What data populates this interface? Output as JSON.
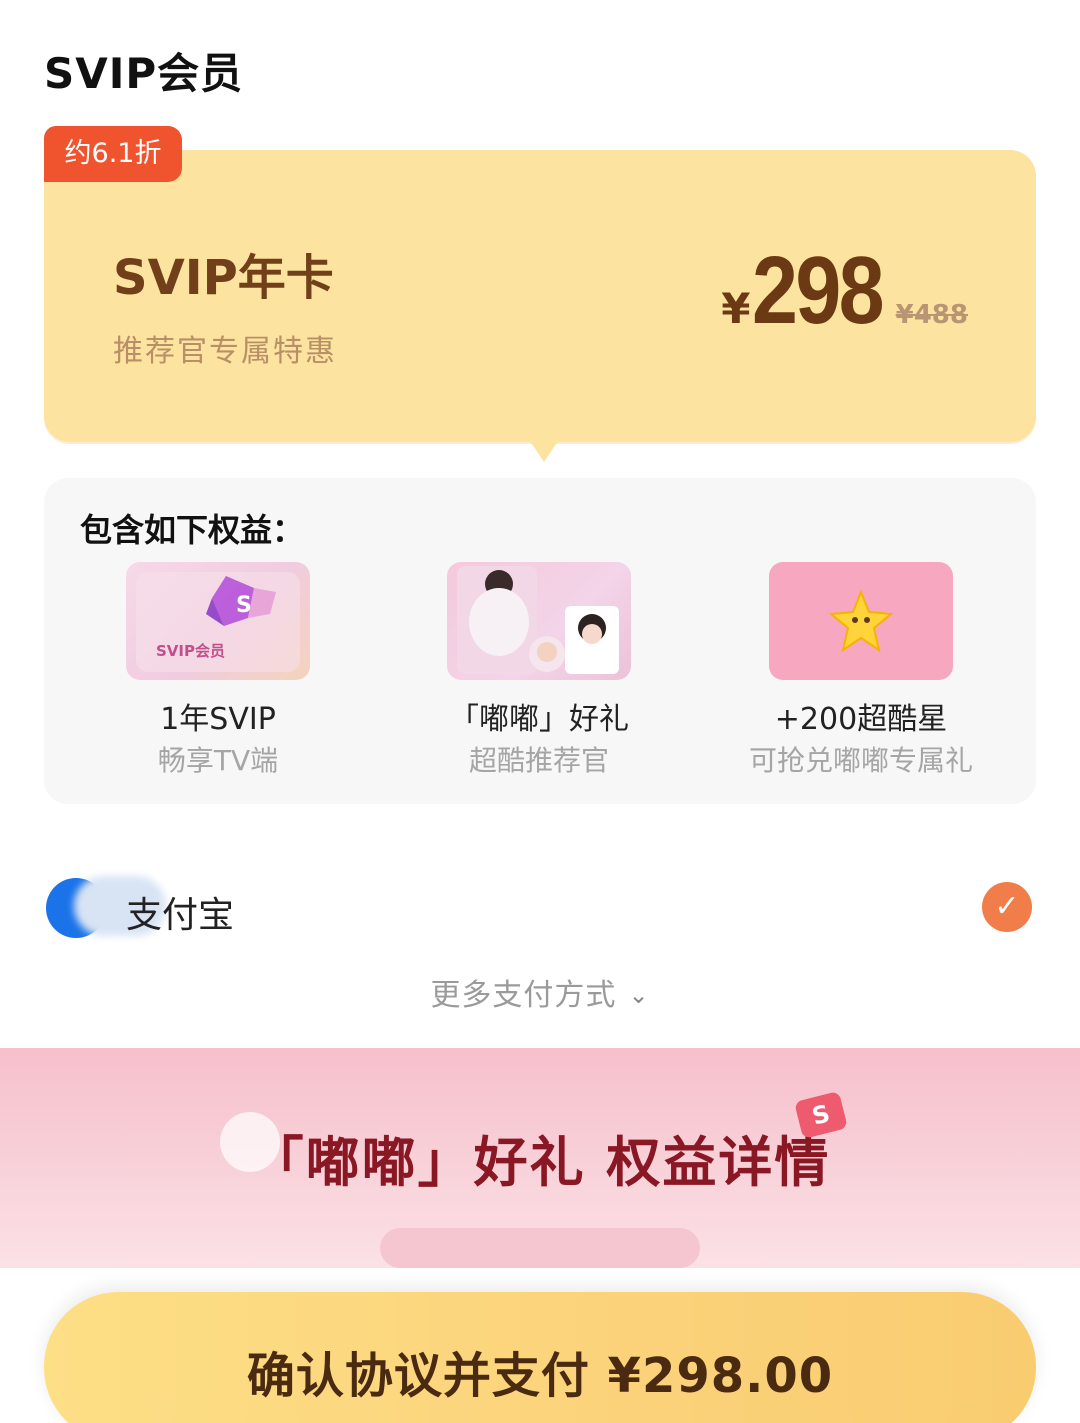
{
  "header": {
    "title": "SVIP会员"
  },
  "plan": {
    "discount_badge": "约6.1折",
    "name": "SVIP年卡",
    "subtitle": "推荐官专属特惠",
    "currency": "¥",
    "price": "298",
    "original_price": "¥488"
  },
  "benefits": {
    "title": "包含如下权益：",
    "items": [
      {
        "label": "1年SVIP",
        "sub": "畅享TV端",
        "image_text": "SVIP会员"
      },
      {
        "label": "「嘟嘟」好礼",
        "sub": "超酷推荐官"
      },
      {
        "label": "+200超酷星",
        "sub": "可抢兑嘟嘟专属礼"
      }
    ]
  },
  "payment": {
    "method": "支付宝",
    "more_label": "更多支付方式"
  },
  "banner": {
    "title": "「嘟嘟」好礼 权益详情"
  },
  "action": {
    "pay_label": "确认协议并支付 ¥298.00"
  },
  "colors": {
    "accent_orange": "#f0542f",
    "card_yellow": "#fce39f",
    "price_brown": "#6b3914",
    "banner_pink": "#f6c0cc"
  }
}
